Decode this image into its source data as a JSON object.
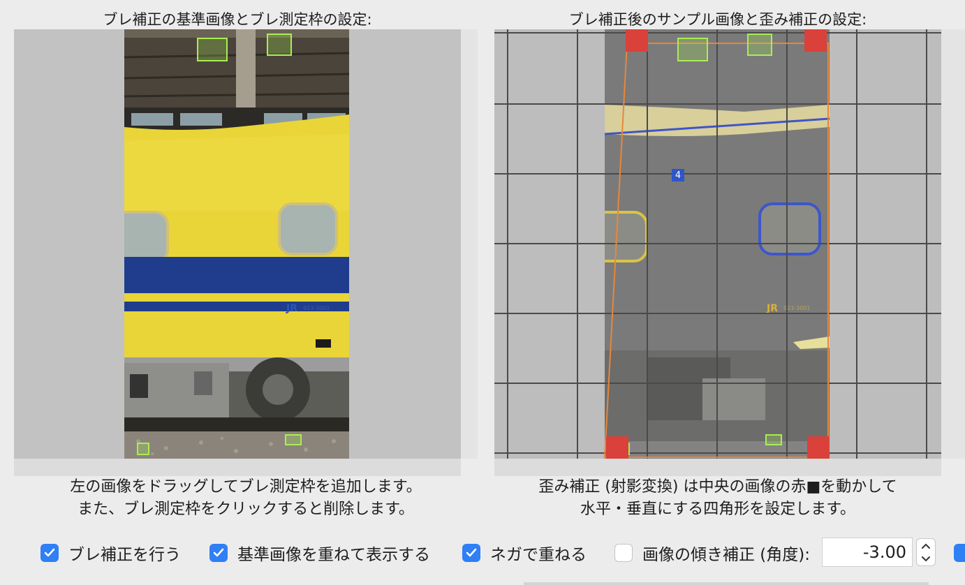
{
  "left_panel": {
    "title": "ブレ補正の基準画像とブレ測定枠の設定:",
    "caption_line1": "左の画像をドラッグしてブレ測定枠を追加します。",
    "caption_line2": "また、ブレ測定枠をクリックすると削除します。",
    "image_icon": "reference-train-photo"
  },
  "right_panel": {
    "title": "ブレ補正後のサンプル画像と歪み補正の設定:",
    "caption_line1": "歪み補正 (射影変換) は中央の画像の赤■を動かして",
    "caption_line2": "水平・垂直にする四角形を設定します。",
    "marker_label": "4",
    "image_icon": "corrected-train-photo"
  },
  "controls": {
    "stabilize": {
      "label": "ブレ補正を行う",
      "checked": true
    },
    "overlay": {
      "label": "基準画像を重ねて表示する",
      "checked": true
    },
    "negative": {
      "label": "ネガで重ねる",
      "checked": true
    },
    "tilt": {
      "label": "画像の傾き補正 (角度):",
      "checked": false
    },
    "angle_value": "-3.00"
  },
  "colors": {
    "accent": "#2f7ff5",
    "measure_frame": "#a8ee54",
    "corner_handle": "#d9413a",
    "perspective_outline": "#e8873a"
  }
}
